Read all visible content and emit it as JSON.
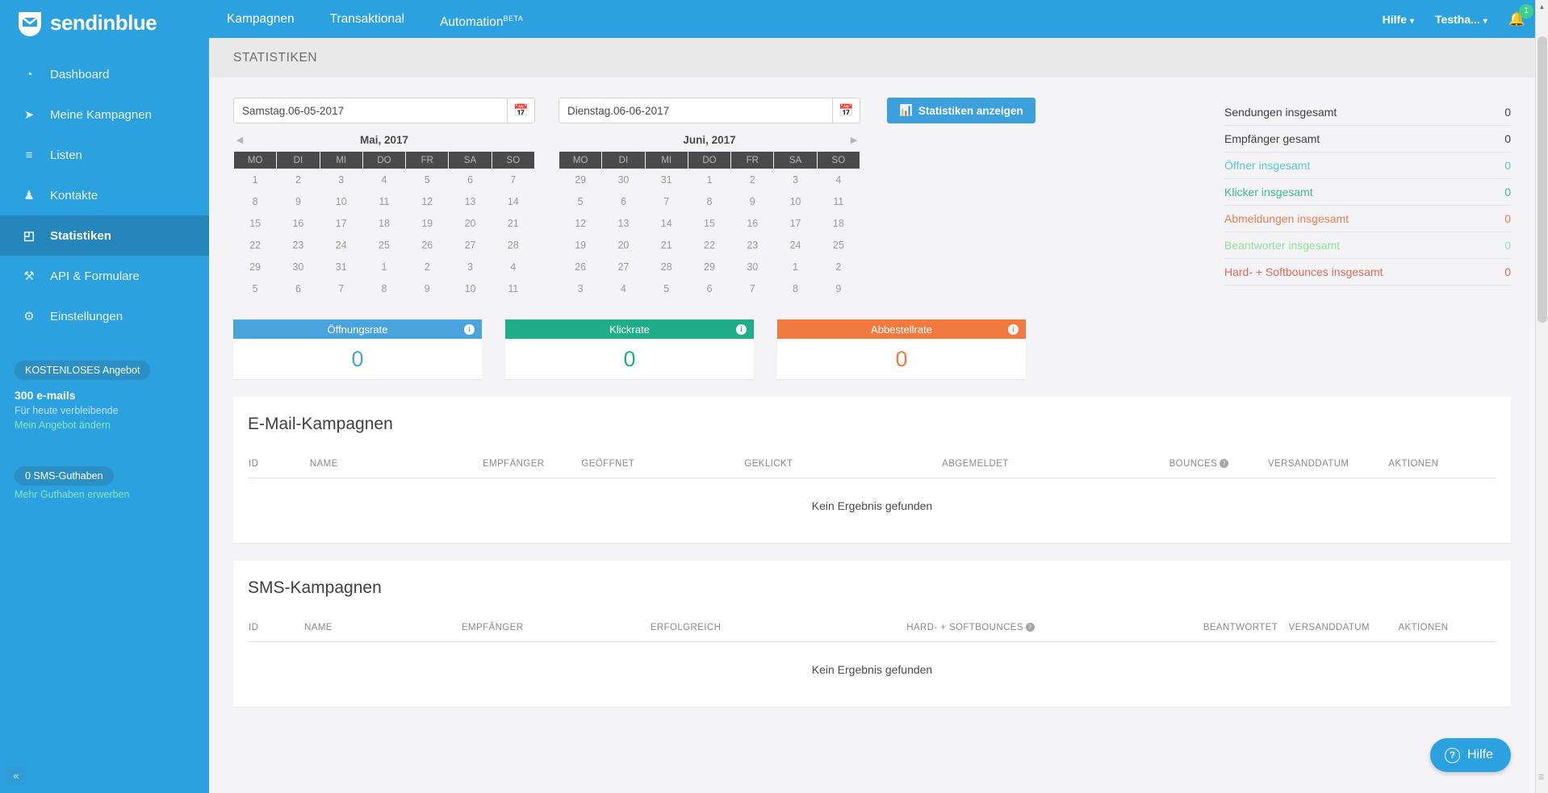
{
  "brand": {
    "name": "sendinblue",
    "logo_icon": "envelope-shield-icon"
  },
  "topnav": {
    "tabs": [
      {
        "label": "Kampagnen",
        "active": true,
        "beta": ""
      },
      {
        "label": "Transaktional",
        "active": false,
        "beta": ""
      },
      {
        "label": "Automation",
        "active": false,
        "beta": "BETA"
      }
    ],
    "help_label": "Hilfe",
    "account_label": "Testha...",
    "notification_count": "1",
    "bell_icon": "bell-icon",
    "caret_icon": "chevron-down-icon"
  },
  "sidebar": {
    "items": [
      {
        "label": "Dashboard",
        "icon": "dashboard-icon",
        "glyph": "◔",
        "active": false
      },
      {
        "label": "Meine Kampagnen",
        "icon": "paper-plane-icon",
        "glyph": "➤",
        "active": false
      },
      {
        "label": "Listen",
        "icon": "list-icon",
        "glyph": "≡",
        "active": false
      },
      {
        "label": "Kontakte",
        "icon": "contacts-icon",
        "glyph": "♟",
        "active": false
      },
      {
        "label": "Statistiken",
        "icon": "chart-area-icon",
        "glyph": "◰",
        "active": true
      },
      {
        "label": "API & Formulare",
        "icon": "wrench-icon",
        "glyph": "⚒",
        "active": false
      },
      {
        "label": "Einstellungen",
        "icon": "gear-icon",
        "glyph": "⚙",
        "active": false
      }
    ],
    "promo": {
      "badge": "KOSTENLOSES Angebot",
      "amount": "300 e-mails",
      "subtitle": "Für heute verbleibende",
      "link": "Mein Angebot ändern"
    },
    "sms": {
      "badge": "0 SMS-Guthaben",
      "link": "Mehr Guthaben erwerben"
    },
    "collapse_icon": "chevron-double-left-icon"
  },
  "page": {
    "title": "STATISTIKEN"
  },
  "datepickers": {
    "start": {
      "value": "Samstag.06-05-2017",
      "calendar_icon": "calendar-icon",
      "month_title": "Mai, 2017",
      "prev_icon": "triangle-left-icon",
      "weekdays": [
        "MO",
        "DI",
        "MI",
        "DO",
        "FR",
        "SA",
        "SO"
      ],
      "weeks": [
        [
          {
            "d": "1",
            "s": "light"
          },
          {
            "d": "2",
            "s": "light"
          },
          {
            "d": "3",
            "s": "light"
          },
          {
            "d": "4",
            "s": "light"
          },
          {
            "d": "5",
            "s": "light"
          },
          {
            "d": "6",
            "s": "sel"
          },
          {
            "d": "7",
            "s": "sel"
          }
        ],
        [
          {
            "d": "8",
            "s": "sel"
          },
          {
            "d": "9",
            "s": "sel"
          },
          {
            "d": "10",
            "s": "sel"
          },
          {
            "d": "11",
            "s": "sel"
          },
          {
            "d": "12",
            "s": "sel"
          },
          {
            "d": "13",
            "s": "sel"
          },
          {
            "d": "14",
            "s": "sel"
          }
        ],
        [
          {
            "d": "15",
            "s": "sel"
          },
          {
            "d": "16",
            "s": "sel"
          },
          {
            "d": "17",
            "s": "sel"
          },
          {
            "d": "18",
            "s": "sel"
          },
          {
            "d": "19",
            "s": "sel"
          },
          {
            "d": "20",
            "s": "sel"
          },
          {
            "d": "21",
            "s": "sel"
          }
        ],
        [
          {
            "d": "22",
            "s": "sel"
          },
          {
            "d": "23",
            "s": "sel"
          },
          {
            "d": "24",
            "s": "sel"
          },
          {
            "d": "25",
            "s": "sel"
          },
          {
            "d": "26",
            "s": "sel"
          },
          {
            "d": "27",
            "s": "sel"
          },
          {
            "d": "28",
            "s": "sel"
          }
        ],
        [
          {
            "d": "29",
            "s": "sel"
          },
          {
            "d": "30",
            "s": "sel"
          },
          {
            "d": "31",
            "s": "sel"
          },
          {
            "d": "1",
            "s": "out"
          },
          {
            "d": "2",
            "s": "out"
          },
          {
            "d": "3",
            "s": "out"
          },
          {
            "d": "4",
            "s": "out"
          }
        ],
        [
          {
            "d": "5",
            "s": "out"
          },
          {
            "d": "6",
            "s": "out"
          },
          {
            "d": "7",
            "s": "out"
          },
          {
            "d": "8",
            "s": "out"
          },
          {
            "d": "9",
            "s": "out"
          },
          {
            "d": "10",
            "s": "out"
          },
          {
            "d": "11",
            "s": "out"
          }
        ]
      ]
    },
    "end": {
      "value": "Dienstag.06-06-2017",
      "calendar_icon": "calendar-icon",
      "month_title": "Juni, 2017",
      "next_icon": "triangle-right-icon",
      "weekdays": [
        "MO",
        "DI",
        "MI",
        "DO",
        "FR",
        "SA",
        "SO"
      ],
      "weeks": [
        [
          {
            "d": "29",
            "s": "out"
          },
          {
            "d": "30",
            "s": "out"
          },
          {
            "d": "31",
            "s": "out"
          },
          {
            "d": "1",
            "s": "sel"
          },
          {
            "d": "2",
            "s": "sel"
          },
          {
            "d": "3",
            "s": "sel"
          },
          {
            "d": "4",
            "s": "sel"
          }
        ],
        [
          {
            "d": "5",
            "s": "sel"
          },
          {
            "d": "6",
            "s": "sel"
          },
          {
            "d": "7",
            "s": "pale"
          },
          {
            "d": "8",
            "s": "pale"
          },
          {
            "d": "9",
            "s": "pale"
          },
          {
            "d": "10",
            "s": "pale"
          },
          {
            "d": "11",
            "s": "pale"
          }
        ],
        [
          {
            "d": "12",
            "s": "pale"
          },
          {
            "d": "13",
            "s": "pale"
          },
          {
            "d": "14",
            "s": "pale"
          },
          {
            "d": "15",
            "s": "pale"
          },
          {
            "d": "16",
            "s": "pale"
          },
          {
            "d": "17",
            "s": "pale"
          },
          {
            "d": "18",
            "s": "pale"
          }
        ],
        [
          {
            "d": "19",
            "s": "pale"
          },
          {
            "d": "20",
            "s": "pale"
          },
          {
            "d": "21",
            "s": "pale"
          },
          {
            "d": "22",
            "s": "pale"
          },
          {
            "d": "23",
            "s": "pale"
          },
          {
            "d": "24",
            "s": "pale"
          },
          {
            "d": "25",
            "s": "pale"
          }
        ],
        [
          {
            "d": "26",
            "s": "pale"
          },
          {
            "d": "27",
            "s": "pale"
          },
          {
            "d": "28",
            "s": "pale"
          },
          {
            "d": "29",
            "s": "pale"
          },
          {
            "d": "30",
            "s": "pale"
          },
          {
            "d": "1",
            "s": "out"
          },
          {
            "d": "2",
            "s": "out"
          }
        ],
        [
          {
            "d": "3",
            "s": "out"
          },
          {
            "d": "4",
            "s": "out"
          },
          {
            "d": "5",
            "s": "out"
          },
          {
            "d": "6",
            "s": "out"
          },
          {
            "d": "7",
            "s": "out"
          },
          {
            "d": "8",
            "s": "out"
          },
          {
            "d": "9",
            "s": "out"
          }
        ]
      ]
    },
    "submit_label": "Statistiken anzeigen",
    "submit_icon": "bar-chart-icon"
  },
  "summary": {
    "rows": [
      {
        "label": "Sendungen insgesamt",
        "value": "0",
        "color": "#3f3f3f"
      },
      {
        "label": "Empfänger gesamt",
        "value": "0",
        "color": "#3f3f3f"
      },
      {
        "label": "Öffner insgesamt",
        "value": "0",
        "color": "#5bc8d4"
      },
      {
        "label": "Klicker insgesamt",
        "value": "0",
        "color": "#3fb98b"
      },
      {
        "label": "Abmeldungen insgesamt",
        "value": "0",
        "color": "#ef7d52"
      },
      {
        "label": "Beantworter insgesamt",
        "value": "0",
        "color": "#95e0a0"
      },
      {
        "label": "Hard- + Softbounces insgesamt",
        "value": "0",
        "color": "#e06a5a"
      }
    ]
  },
  "rate_cards": [
    {
      "title": "Öffnungsrate",
      "value": "0",
      "color": "#4ba3dd",
      "info_icon": "info-icon"
    },
    {
      "title": "Klickrate",
      "value": "0",
      "color": "#1fae87",
      "info_icon": "info-icon"
    },
    {
      "title": "Abbestellrate",
      "value": "0",
      "color": "#f07a40",
      "info_icon": "info-icon"
    }
  ],
  "email_table": {
    "title": "E-Mail-Kampagnen",
    "columns": [
      "ID",
      "NAME",
      "EMPFÄNGER",
      "GEÖFFNET",
      "GEKLICKT",
      "ABGEMELDET",
      "BOUNCES",
      "VERSANDDATUM",
      "AKTIONEN"
    ],
    "bounces_help_icon": "question-circle-icon",
    "empty_message": "Kein Ergebnis gefunden"
  },
  "sms_table": {
    "title": "SMS-Kampagnen",
    "columns": [
      "ID",
      "NAME",
      "EMPFÄNGER",
      "ERFOLGREICH",
      "HARD- + SOFTBOUNCES",
      "BEANTWORTET",
      "VERSANDDATUM",
      "AKTIONEN"
    ],
    "bounces_help_icon": "question-circle-icon",
    "empty_message": "Kein Ergebnis gefunden"
  },
  "help_widget": {
    "label": "Hilfe",
    "icon": "question-circle-icon"
  },
  "scrollbar": {
    "up_icon": "triangle-up-icon",
    "down_icon": "triangle-down-icon"
  }
}
